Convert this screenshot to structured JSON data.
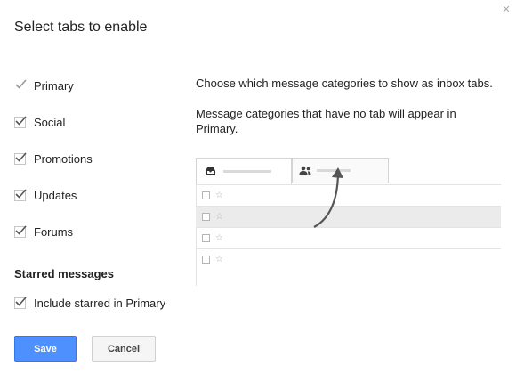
{
  "dialog": {
    "title": "Select tabs to enable",
    "close_glyph": "×",
    "tabs": [
      {
        "label": "Primary",
        "checked": true,
        "disabled": true
      },
      {
        "label": "Social",
        "checked": true,
        "disabled": false
      },
      {
        "label": "Promotions",
        "checked": true,
        "disabled": false
      },
      {
        "label": "Updates",
        "checked": true,
        "disabled": false
      },
      {
        "label": "Forums",
        "checked": true,
        "disabled": false
      }
    ],
    "starred_section": {
      "title": "Starred messages",
      "option_label": "Include starred in Primary",
      "checked": true
    },
    "description": {
      "line1": "Choose which message categories to show as inbox tabs.",
      "line2": "Message categories that have no tab will appear in",
      "line3": "Primary."
    },
    "preview": {
      "tab1_icon": "inbox-icon",
      "tab2_icon": "people-icon",
      "row_count": 4,
      "highlighted_row": 1
    },
    "buttons": {
      "save": "Save",
      "cancel": "Cancel"
    },
    "colors": {
      "primary_button": "#4d90fe",
      "check_mark": "#555555",
      "disabled_check": "#999999"
    }
  }
}
